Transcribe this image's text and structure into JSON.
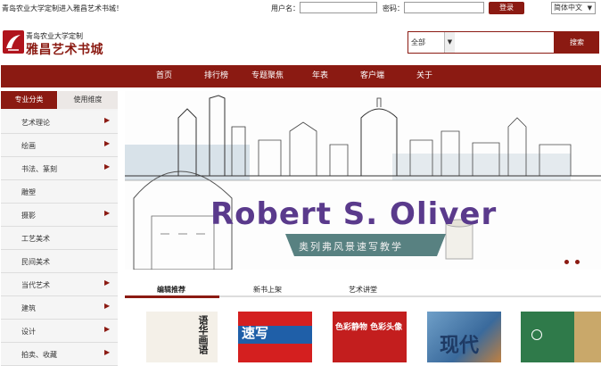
{
  "topbar": {
    "welcome": "青岛农业大学定制进入雅昌艺术书城！",
    "username_label": "用户名：",
    "password_label": "密码：",
    "login_button": "登录",
    "language": "简体中文"
  },
  "header": {
    "logo_subtitle": "青岛农业大学定制",
    "logo_title": "雅昌艺术书城",
    "search_category": "全部",
    "search_button": "搜索"
  },
  "nav": {
    "items": [
      "首页",
      "排行榜",
      "专题聚焦",
      "年表",
      "客户端",
      "关于"
    ]
  },
  "sidebar": {
    "tabs": [
      "专业分类",
      "使用维度"
    ],
    "items": [
      "艺术理论",
      "绘画",
      "书法、篆刻",
      "雕塑",
      "摄影",
      "工艺美术",
      "民间美术",
      "当代艺术",
      "建筑",
      "设计",
      "拍卖、收藏"
    ],
    "arrow_items": [
      true,
      true,
      true,
      false,
      true,
      false,
      false,
      true,
      true,
      true,
      true
    ]
  },
  "banner": {
    "title": "Robert S. Oliver",
    "subtitle": "奥列弗风景速写教学"
  },
  "content_tabs": [
    "编辑推荐",
    "新书上架",
    "艺术讲堂"
  ],
  "books": [
    {
      "title": "语华画语",
      "color": "#f4f0e8"
    },
    {
      "title": "速写",
      "color": "#d41f1f"
    },
    {
      "title": "色彩静物 色彩头像",
      "color": "#c31e1e"
    },
    {
      "title": "现代",
      "color": "#3a6a9c"
    },
    {
      "title": "",
      "color": "#2f7a4a"
    }
  ],
  "colors": {
    "brand": "#8b1a12",
    "nav_bg": "#8b1a12",
    "sidebar_bg": "#f3f3f3"
  }
}
